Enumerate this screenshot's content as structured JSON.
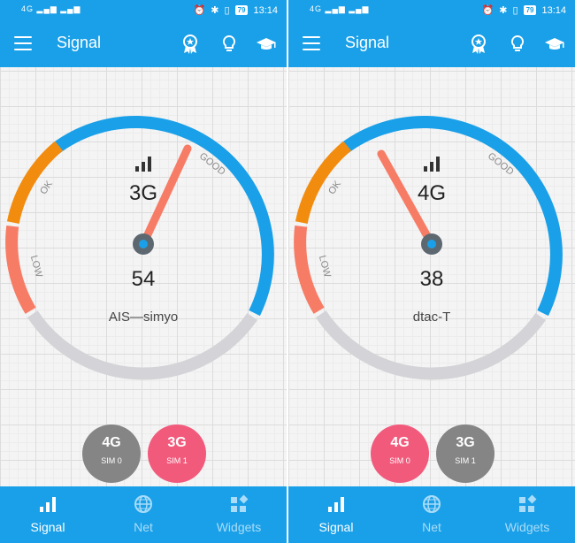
{
  "colors": {
    "primary": "#1aa0e8",
    "good_arc": "#1aa0e8",
    "ok_arc": "#f28c0f",
    "low_arc": "#f77c66",
    "empty_arc": "#d4d4d8",
    "needle": "#f77c66",
    "sim_gray": "#858585",
    "sim_pink": "#f25a7c"
  },
  "screens": [
    {
      "status": {
        "network": "4G",
        "battery": "79",
        "time": "13:14"
      },
      "app_title": "Signal",
      "gauge": {
        "labels": {
          "good": "GOOD",
          "ok": "OK",
          "low": "LOW"
        },
        "network_type": "3G",
        "level": "54",
        "carrier": "AIS—simyo"
      },
      "sims": [
        {
          "type": "4G",
          "label": "SIM 0",
          "color": "#858585"
        },
        {
          "type": "3G",
          "label": "SIM 1",
          "color": "#f25a7c"
        }
      ],
      "nav": {
        "signal": "Signal",
        "net": "Net",
        "widgets": "Widgets"
      }
    },
    {
      "status": {
        "network": "4G",
        "battery": "79",
        "time": "13:14"
      },
      "app_title": "Signal",
      "gauge": {
        "labels": {
          "good": "GOOD",
          "ok": "OK",
          "low": "LOW"
        },
        "network_type": "4G",
        "level": "38",
        "carrier": "dtac-T"
      },
      "sims": [
        {
          "type": "4G",
          "label": "SIM 0",
          "color": "#f25a7c"
        },
        {
          "type": "3G",
          "label": "SIM 1",
          "color": "#858585"
        }
      ],
      "nav": {
        "signal": "Signal",
        "net": "Net",
        "widgets": "Widgets"
      }
    }
  ]
}
